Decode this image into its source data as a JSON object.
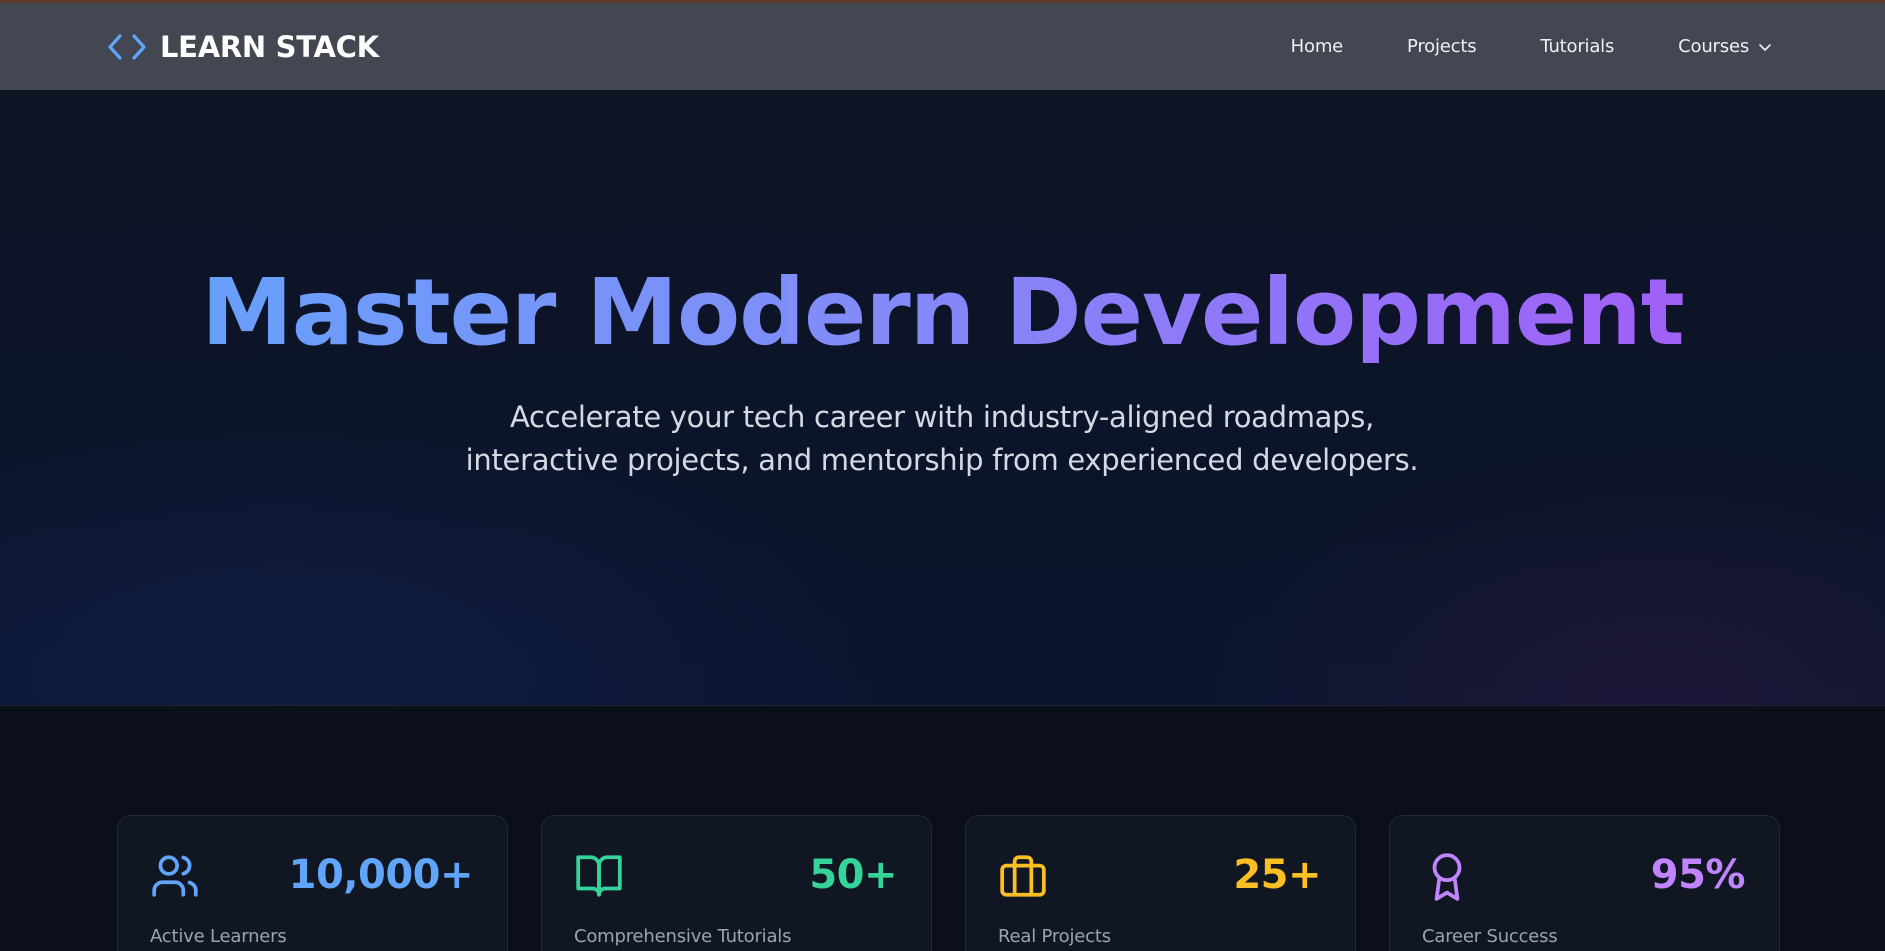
{
  "brand": {
    "name": "LEARN STACK",
    "icon": "code-brackets-icon"
  },
  "nav": {
    "items": [
      {
        "label": "Home"
      },
      {
        "label": "Projects"
      },
      {
        "label": "Tutorials"
      },
      {
        "label": "Courses",
        "icon": "chevron-down-icon"
      }
    ]
  },
  "hero": {
    "title": "Master Modern Development",
    "subtitle": "Accelerate your tech career with industry-aligned roadmaps, interactive projects, and mentorship from experienced developers."
  },
  "stats": [
    {
      "value": "10,000+",
      "label": "Active Learners",
      "icon": "users-icon",
      "color": "#60a5fa"
    },
    {
      "value": "50+",
      "label": "Comprehensive Tutorials",
      "icon": "book-open-icon",
      "color": "#34d399"
    },
    {
      "value": "25+",
      "label": "Real Projects",
      "icon": "briefcase-icon",
      "color": "#fbbf24"
    },
    {
      "value": "95%",
      "label": "Career Success",
      "icon": "award-icon",
      "color": "#c084fc"
    }
  ],
  "colors": {
    "navbar": "#434751",
    "gradient_start": "#60a5fa",
    "gradient_end": "#a855f7",
    "background": "#0a0d17"
  }
}
